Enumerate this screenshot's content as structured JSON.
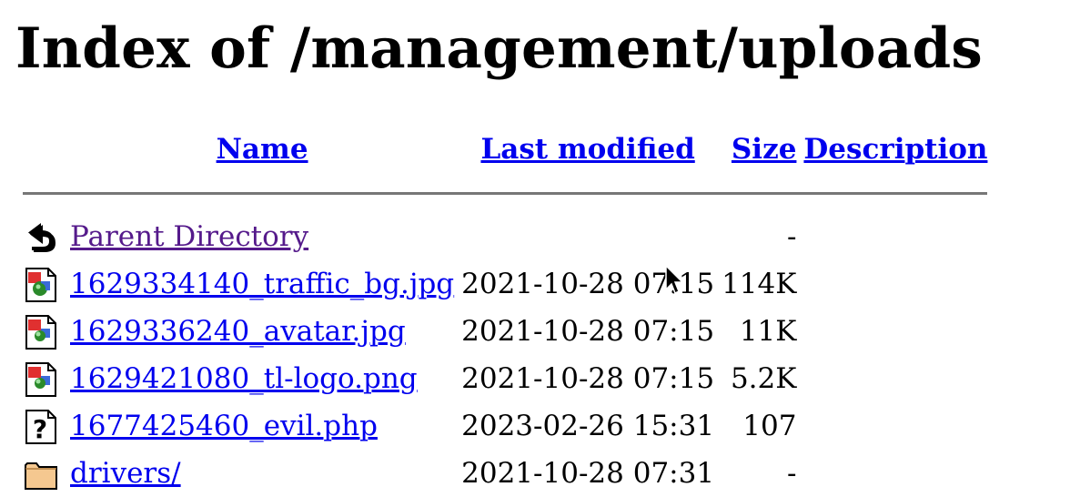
{
  "page": {
    "title": "Index of /management/uploads"
  },
  "columns": {
    "name": "Name",
    "last_modified": "Last modified",
    "size": "Size",
    "description": "Description"
  },
  "parent": {
    "label": "Parent Directory",
    "size": "-",
    "icon": "back-arrow-icon"
  },
  "entries": [
    {
      "name": "1629334140_traffic_bg.jpg",
      "modified": "2021-10-28 07:15",
      "size": "114K",
      "description": "",
      "icon": "image-icon"
    },
    {
      "name": "1629336240_avatar.jpg",
      "modified": "2021-10-28 07:15",
      "size": "11K",
      "description": "",
      "icon": "image-icon"
    },
    {
      "name": "1629421080_tl-logo.png",
      "modified": "2021-10-28 07:15",
      "size": "5.2K",
      "description": "",
      "icon": "image-icon"
    },
    {
      "name": "1677425460_evil.php",
      "modified": "2023-02-26 15:31",
      "size": "107",
      "description": "",
      "icon": "unknown-file-icon"
    },
    {
      "name": "drivers/",
      "modified": "2021-10-28 07:31",
      "size": "-",
      "description": "",
      "icon": "folder-icon"
    }
  ],
  "colors": {
    "link": "#0000ee",
    "visited_link": "#551a8b",
    "rule": "#777777"
  }
}
